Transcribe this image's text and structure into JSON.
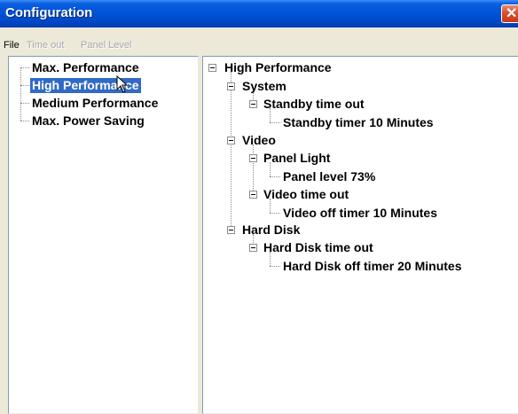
{
  "window": {
    "title": "Configuration"
  },
  "menu": {
    "file": "File",
    "time_out": "Time out",
    "panel_level": "Panel Level"
  },
  "left_tree": {
    "items": [
      {
        "label": "Max. Performance",
        "selected": false
      },
      {
        "label": "High Performance",
        "selected": true
      },
      {
        "label": "Medium Performance",
        "selected": false
      },
      {
        "label": "Max. Power Saving",
        "selected": false
      }
    ]
  },
  "right_tree": {
    "root": "High Performance",
    "system": "System",
    "standby_timeout": "Standby time out",
    "standby_timer": "Standby timer 10 Minutes",
    "video": "Video",
    "panel_light": "Panel Light",
    "panel_level": "Panel level 73%",
    "video_timeout": "Video time out",
    "video_off_timer": "Video off timer 10 Minutes",
    "hard_disk": "Hard Disk",
    "hard_disk_timeout": "Hard Disk time out",
    "hard_disk_off_timer": "Hard Disk off timer 20 Minutes"
  },
  "icons": {
    "close": "close-icon",
    "expander": "minus-box-icon",
    "cursor": "arrow-cursor-icon"
  },
  "colors": {
    "title_bar": "#0052d6",
    "selection": "#316ac5",
    "close_button": "#d8502f"
  }
}
